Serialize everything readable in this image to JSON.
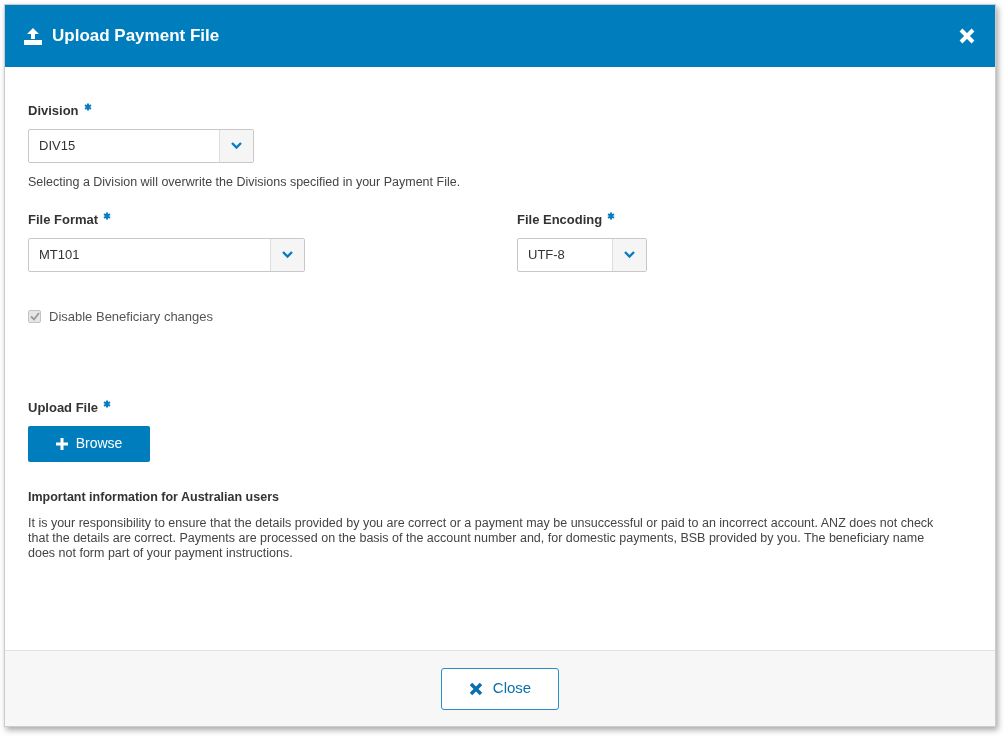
{
  "dialog": {
    "title": "Upload Payment File"
  },
  "division": {
    "label": "Division",
    "required": true,
    "value": "DIV15",
    "help": "Selecting a Division will overwrite the Divisions specified in your Payment File."
  },
  "file_format": {
    "label": "File Format",
    "required": true,
    "value": "MT101"
  },
  "file_encoding": {
    "label": "File Encoding",
    "required": true,
    "value": "UTF-8"
  },
  "disable_beneficiary": {
    "label": "Disable Beneficiary changes",
    "checked": true,
    "disabled": true
  },
  "upload_file": {
    "label": "Upload File",
    "required": true,
    "button": "Browse"
  },
  "info": {
    "heading": "Important information for Australian users",
    "text": "It is your responsibility to ensure that the details provided by you are correct or a payment may be unsuccessful or paid to an incorrect account. ANZ does not check that the details are correct. Payments are processed on the basis of the account number and, for domestic payments, BSB provided by you. The beneficiary name does not form part of your payment instructions."
  },
  "footer": {
    "close_button": "Close"
  }
}
